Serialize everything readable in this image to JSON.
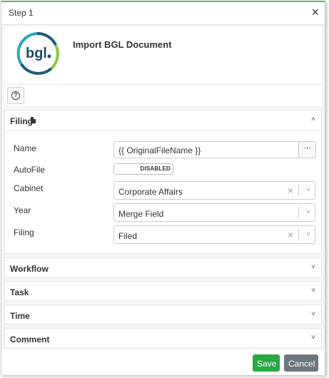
{
  "dialog": {
    "title": "Step 1",
    "close_label": "×"
  },
  "header": {
    "logo_text": "bgl",
    "name": "Import BGL Document"
  },
  "help": {
    "icon_label": "?"
  },
  "filing": {
    "label": "Filing",
    "fields": {
      "name_label": "Name",
      "name_value": "{{ OriginalFileName }}",
      "name_button": "···",
      "autofile_label": "AutoFile",
      "autofile_state": "DISABLED",
      "cabinet_label": "Cabinet",
      "cabinet_value": "Corporate Affairs",
      "year_label": "Year",
      "year_value": "Merge Field",
      "filing_label": "Filing",
      "filing_value": "Filed"
    }
  },
  "panels": {
    "workflow": "Workflow",
    "task": "Task",
    "time": "Time",
    "comment": "Comment"
  },
  "footer": {
    "save": "Save",
    "cancel": "Cancel"
  },
  "colors": {
    "accent_green": "#28a745",
    "cancel_gray": "#6c757d",
    "logo_blue": "#1f5a7a",
    "logo_teal": "#2aa7b8",
    "logo_green": "#8dc63f"
  }
}
